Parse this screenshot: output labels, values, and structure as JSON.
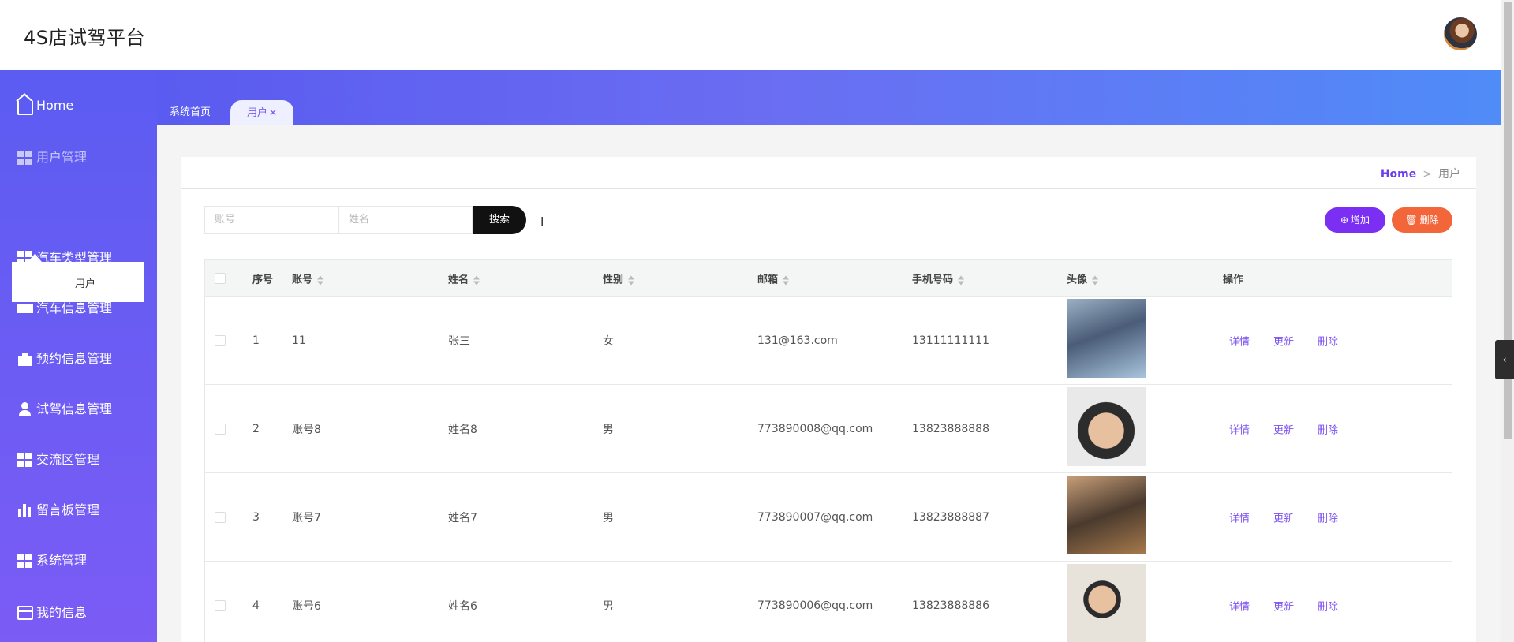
{
  "app": {
    "title": "4S店试驾平台"
  },
  "tabs": [
    {
      "label": "系统首页"
    },
    {
      "label": "用户",
      "close": "✕"
    }
  ],
  "sidebar": {
    "items": [
      {
        "label": "Home",
        "icon": "home-icon"
      },
      {
        "label": "用户管理",
        "icon": "grid-icon"
      },
      {
        "label": "汽车类型管理",
        "icon": "grid-icon"
      },
      {
        "label": "汽车信息管理",
        "icon": "car-icon"
      },
      {
        "label": "预约信息管理",
        "icon": "briefcase-icon"
      },
      {
        "label": "试驾信息管理",
        "icon": "user-icon"
      },
      {
        "label": "交流区管理",
        "icon": "grid-icon"
      },
      {
        "label": "留言板管理",
        "icon": "bar-chart-icon"
      },
      {
        "label": "系统管理",
        "icon": "grid-icon"
      },
      {
        "label": "我的信息",
        "icon": "card-icon"
      }
    ],
    "submenu": {
      "label": "用户"
    }
  },
  "breadcrumb": {
    "home": "Home",
    "separator": ">",
    "current": "用户"
  },
  "search": {
    "account_placeholder": "账号",
    "name_placeholder": "姓名",
    "button": "搜索"
  },
  "actions": {
    "add": "增加",
    "delete": "删除",
    "add_icon": "⊕",
    "delete_icon": "🗑"
  },
  "table": {
    "headers": [
      "序号",
      "账号",
      "姓名",
      "性别",
      "邮箱",
      "手机号码",
      "头像",
      "操作"
    ],
    "rows": [
      {
        "index": "1",
        "account": "11",
        "name": "张三",
        "gender": "女",
        "email": "131@163.com",
        "phone": "13111111111"
      },
      {
        "index": "2",
        "account": "账号8",
        "name": "姓名8",
        "gender": "男",
        "email": "773890008@qq.com",
        "phone": "13823888888"
      },
      {
        "index": "3",
        "account": "账号7",
        "name": "姓名7",
        "gender": "男",
        "email": "773890007@qq.com",
        "phone": "13823888887"
      },
      {
        "index": "4",
        "account": "账号6",
        "name": "姓名6",
        "gender": "男",
        "email": "773890006@qq.com",
        "phone": "13823888886"
      }
    ],
    "row_actions": {
      "detail": "详情",
      "update": "更新",
      "delete": "删除"
    }
  },
  "colors": {
    "accent": "#7b2ff2",
    "danger": "#f2663a",
    "sidebar": "#5b5cf2"
  }
}
